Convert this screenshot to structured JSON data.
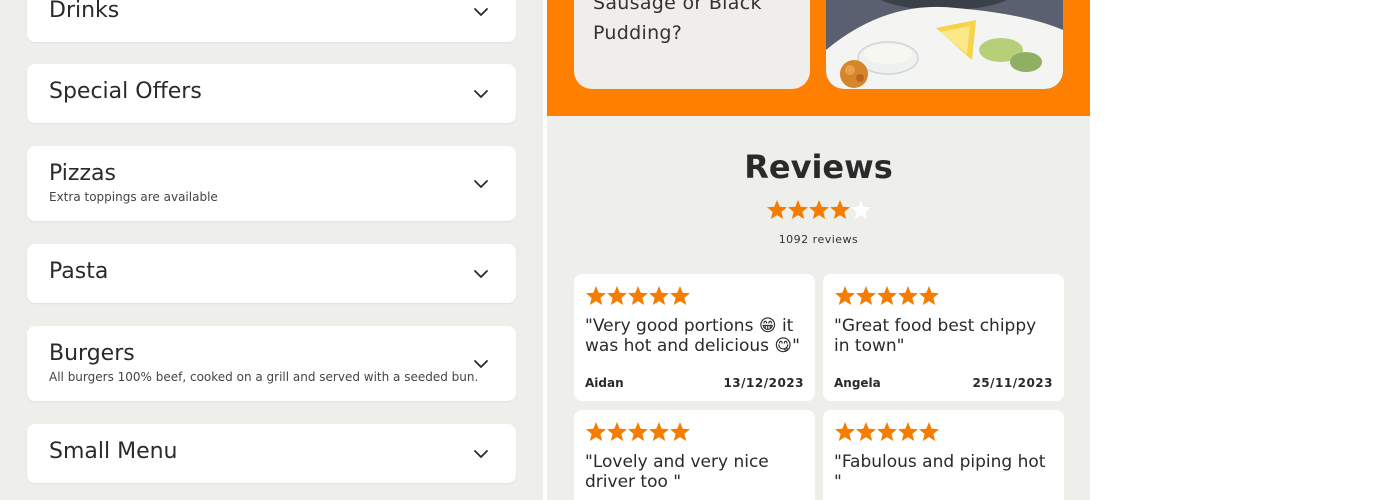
{
  "menu": {
    "categories": [
      {
        "title": "Drinks",
        "description": ""
      },
      {
        "title": "Special Offers",
        "description": ""
      },
      {
        "title": "Pizzas",
        "description": "Extra toppings are available"
      },
      {
        "title": "Pasta",
        "description": ""
      },
      {
        "title": "Burgers",
        "description": "All burgers 100% beef, cooked on a grill and served with a seeded bun."
      },
      {
        "title": "Small Menu",
        "description": ""
      }
    ]
  },
  "promo": {
    "text": "Sausage or Black Pudding?"
  },
  "reviews": {
    "title": "Reviews",
    "rating": 4,
    "rating_max": 5,
    "count_label": "1092 reviews",
    "items": [
      {
        "stars": 5,
        "text": "\"Very good portions 😁 it was hot and delicious 😋\"",
        "author": "Aidan",
        "date": "13/12/2023"
      },
      {
        "stars": 5,
        "text": "\"Great food best chippy in town\"",
        "author": "Angela",
        "date": "25/11/2023"
      },
      {
        "stars": 5,
        "text": "\"Lovely and very nice driver too  \"",
        "author": "",
        "date": ""
      },
      {
        "stars": 5,
        "text": "\"Fabulous and piping hot  \"",
        "author": "",
        "date": ""
      }
    ]
  },
  "colors": {
    "accent": "#ff8000",
    "star_filled": "#f47c00",
    "star_empty": "#ffffff",
    "panel_bg": "#eeeeeb"
  }
}
